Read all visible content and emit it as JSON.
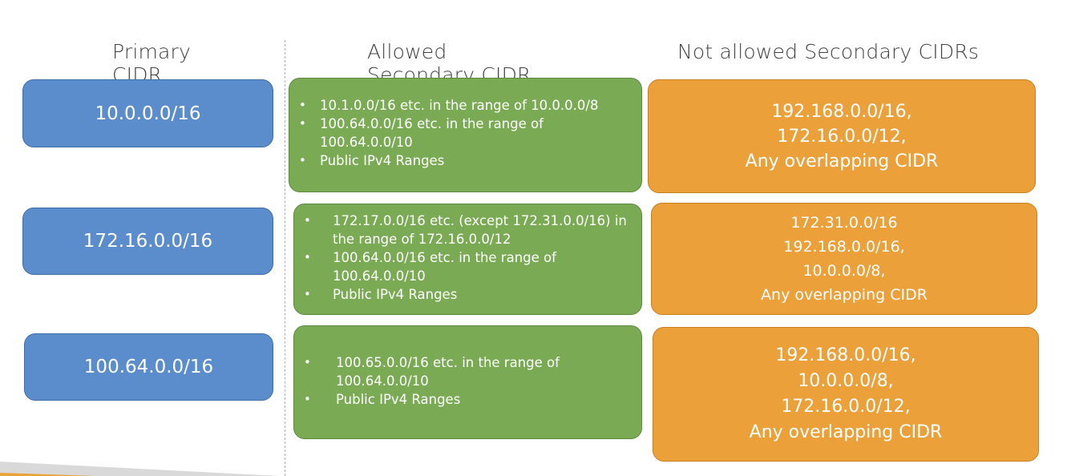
{
  "headers": {
    "primary": "Primary CIDR",
    "allowed": "Allowed Secondary CIDR",
    "not_allowed": "Not allowed Secondary CIDRs"
  },
  "rows": [
    {
      "primary": "10.0.0.0/16",
      "allowed": [
        "10.1.0.0/16 etc. in the range of 10.0.0.0/8",
        "100.64.0.0/16 etc. in the range of 100.64.0.0/10",
        "Public IPv4 Ranges"
      ],
      "not_allowed": [
        "192.168.0.0/16,",
        "172.16.0.0/12,",
        "Any overlapping CIDR"
      ]
    },
    {
      "primary": "172.16.0.0/16",
      "allowed": [
        "172.17.0.0/16 etc. (except 172.31.0.0/16) in the range of 172.16.0.0/12",
        "100.64.0.0/16 etc. in the range of 100.64.0.0/10",
        "Public IPv4 Ranges"
      ],
      "not_allowed": [
        "172.31.0.0/16",
        "192.168.0.0/16,",
        "10.0.0.0/8,",
        "Any overlapping CIDR"
      ]
    },
    {
      "primary": "100.64.0.0/16",
      "allowed": [
        "100.65.0.0/16 etc. in the range of 100.64.0.0/10",
        "Public IPv4 Ranges"
      ],
      "not_allowed": [
        "192.168.0.0/16,",
        "10.0.0.0/8,",
        "172.16.0.0/12,",
        "Any overlapping CIDR"
      ]
    }
  ],
  "colors": {
    "primary_box": "#5b8ccc",
    "allowed_box": "#7aaa54",
    "not_allowed_box": "#eba039",
    "corner_accent": "#e8a33a"
  }
}
